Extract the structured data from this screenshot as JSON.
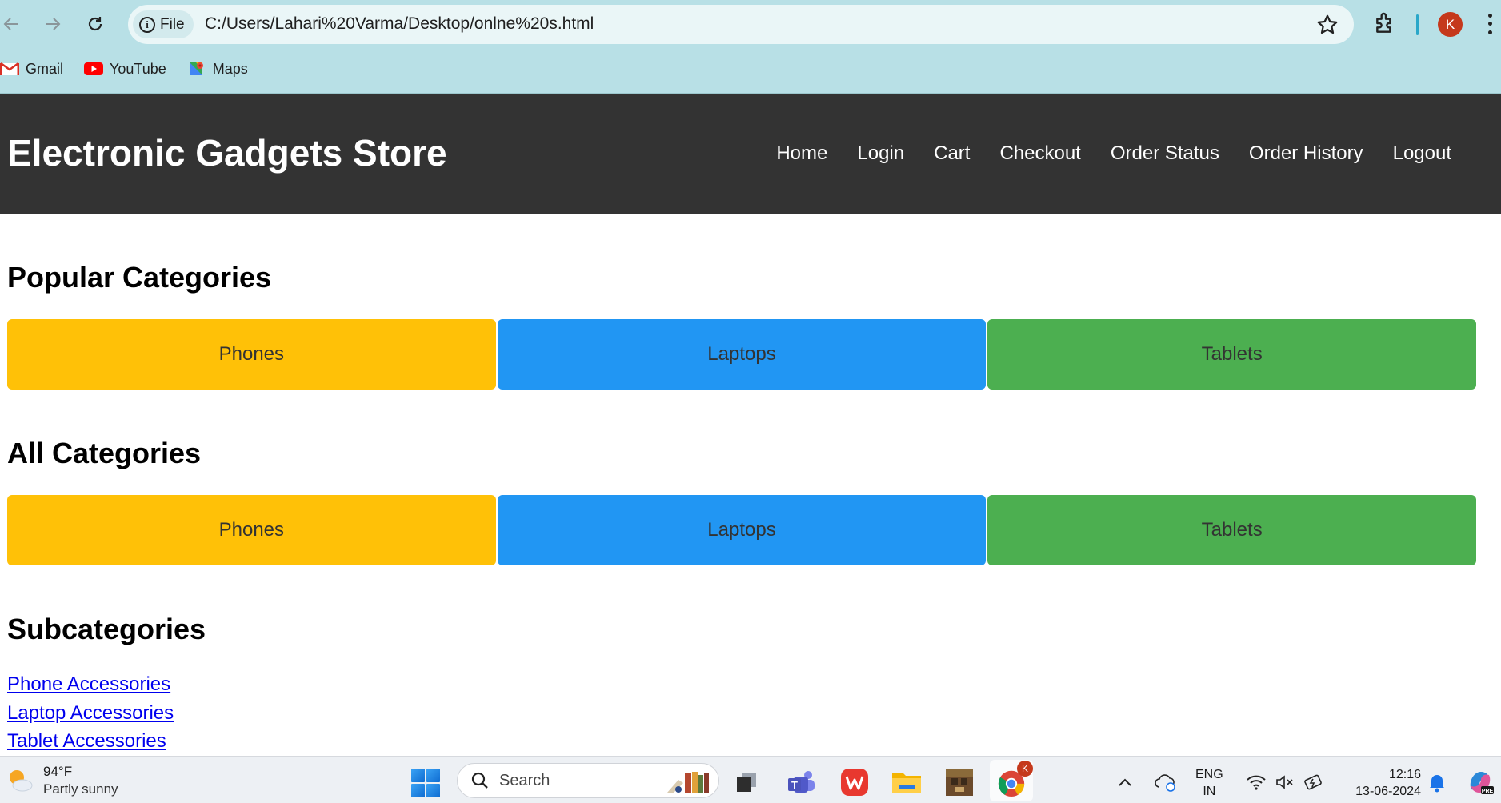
{
  "browser": {
    "site_chip": "File",
    "url": "C:/Users/Lahari%20Varma/Desktop/onlne%20s.html",
    "profile_initial": "K",
    "bookmarks": [
      {
        "label": "Gmail",
        "icon": "gmail-icon"
      },
      {
        "label": "YouTube",
        "icon": "youtube-icon"
      },
      {
        "label": "Maps",
        "icon": "maps-icon"
      }
    ]
  },
  "site": {
    "title": "Electronic Gadgets Store",
    "nav": [
      "Home",
      "Login",
      "Cart",
      "Checkout",
      "Order Status",
      "Order History",
      "Logout"
    ]
  },
  "popular": {
    "heading": "Popular Categories",
    "items": [
      {
        "label": "Phones",
        "color": "#ffc107"
      },
      {
        "label": "Laptops",
        "color": "#2196f3"
      },
      {
        "label": "Tablets",
        "color": "#4caf50"
      }
    ]
  },
  "all": {
    "heading": "All Categories",
    "items": [
      {
        "label": "Phones",
        "color": "#ffc107"
      },
      {
        "label": "Laptops",
        "color": "#2196f3"
      },
      {
        "label": "Tablets",
        "color": "#4caf50"
      }
    ]
  },
  "subcategories": {
    "heading": "Subcategories",
    "links": [
      "Phone Accessories",
      "Laptop Accessories",
      "Tablet Accessories"
    ]
  },
  "taskbar": {
    "weather_temp": "94°F",
    "weather_desc": "Partly sunny",
    "search_label": "Search",
    "chrome_badge": "K",
    "lang_top": "ENG",
    "lang_bottom": "IN",
    "time": "12:16",
    "date": "13-06-2024"
  }
}
